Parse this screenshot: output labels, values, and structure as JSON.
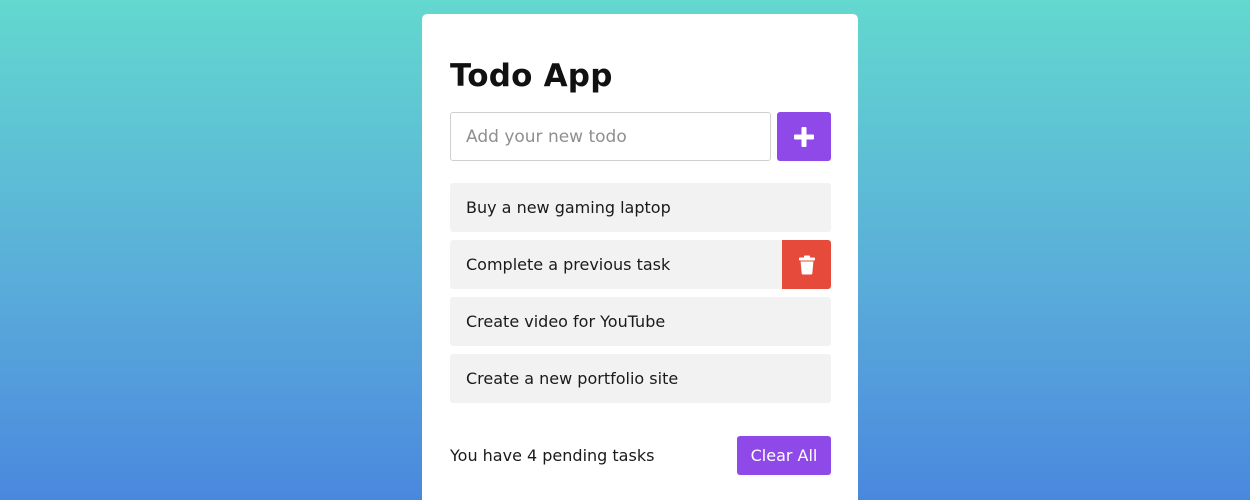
{
  "app": {
    "title": "Todo App"
  },
  "input": {
    "placeholder": "Add your new todo",
    "value": ""
  },
  "add_button": {
    "icon": "plus-icon"
  },
  "todos": [
    {
      "text": "Buy a new gaming laptop",
      "show_delete": false
    },
    {
      "text": "Complete a previous task",
      "show_delete": true
    },
    {
      "text": "Create video for YouTube",
      "show_delete": false
    },
    {
      "text": "Create a new portfolio site",
      "show_delete": false
    }
  ],
  "delete_button": {
    "icon": "trash-icon"
  },
  "footer": {
    "pending_text": "You have 4 pending tasks",
    "clear_label": "Clear All"
  },
  "colors": {
    "accent": "#8e49e8",
    "danger": "#e64a3b",
    "item_bg": "#f2f2f2",
    "bg_top": "#62d8cf",
    "bg_bottom": "#4a88de"
  }
}
